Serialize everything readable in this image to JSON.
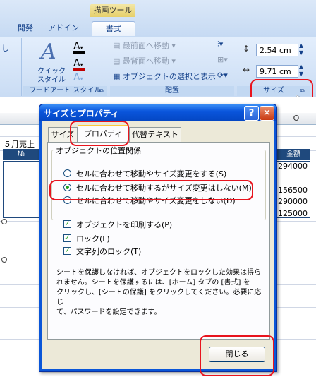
{
  "ribbon": {
    "context_label": "描画ツール",
    "tabs": [
      "開発",
      "アドイン",
      "書式"
    ],
    "left_fragment": "し",
    "wordart": {
      "quick_style_line1": "クイック",
      "quick_style_line2": "スタイル",
      "group_label": "ワードアート スタイル"
    },
    "arrange": {
      "bring_forward": "最前面へ移動",
      "send_backward": "最背面へ移動",
      "selection_pane": "オブジェクトの選択と表示",
      "group_label": "配置"
    },
    "size": {
      "height_value": "2.54 cm",
      "width_value": "9.71 cm",
      "group_label": "サイズ"
    }
  },
  "sheet": {
    "col_headers": [
      "I",
      "O"
    ],
    "title_cell": "５月売上",
    "no_header": "№",
    "amount_header": "金額",
    "amounts": [
      "294000",
      "156500",
      "290000",
      "125000"
    ]
  },
  "dialog": {
    "title": "サイズとプロパティ",
    "help": "?",
    "close_x": "✕",
    "tabs": {
      "size": "サイズ",
      "properties": "プロパティ",
      "alt_text": "代替テキスト"
    },
    "section_title": "オブジェクトの位置関係",
    "radios": [
      {
        "label": "セルに合わせて移動やサイズ変更をする(S)",
        "checked": false
      },
      {
        "label": "セルに合わせて移動するがサイズ変更はしない(M)",
        "checked": true
      },
      {
        "label": "セルに合わせて移動やサイズ変更をしない(D)",
        "checked": false
      }
    ],
    "checks": [
      {
        "label": "オブジェクトを印刷する(P)",
        "checked": true
      },
      {
        "label": "ロック(L)",
        "checked": true
      },
      {
        "label": "文字列のロック(T)",
        "checked": true
      }
    ],
    "note_lines": [
      "シートを保護しなければ、オブジェクトをロックした効果は得ら",
      "れません。シートを保護するには、[ホーム] タブの [書式] を",
      "クリックし、[シートの保護] をクリックしてください。必要に応じ",
      "て、パスワードを設定できます。"
    ],
    "close_button": "閉じる"
  }
}
